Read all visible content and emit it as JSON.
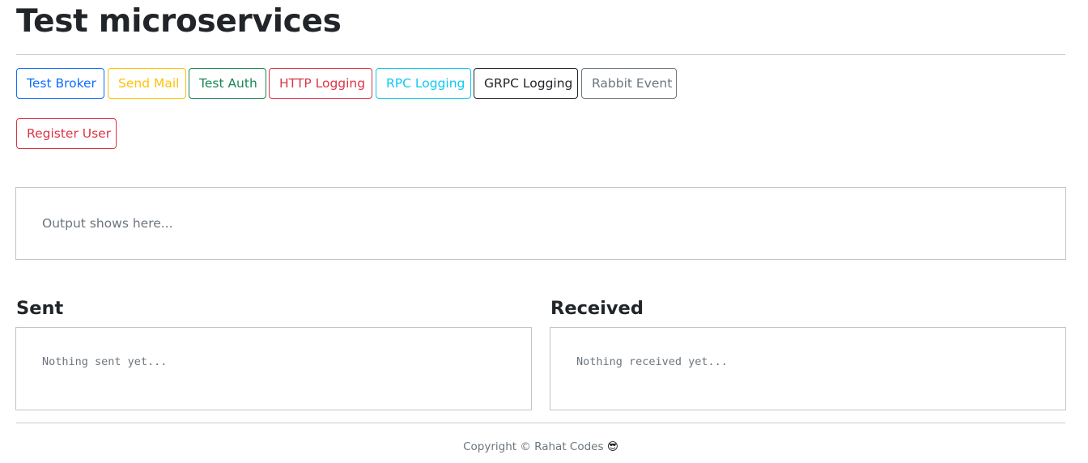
{
  "header": {
    "title": "Test microservices"
  },
  "buttons": [
    {
      "label": "Test Broker",
      "variant": "primary",
      "color": "#0d6efd"
    },
    {
      "label": "Send Mail",
      "variant": "warning",
      "color": "#ffc107"
    },
    {
      "label": "Test Auth",
      "variant": "success",
      "color": "#198754"
    },
    {
      "label": "HTTP Logging",
      "variant": "danger",
      "color": "#dc3545"
    },
    {
      "label": "RPC Logging",
      "variant": "info",
      "color": "#0dcaf0"
    },
    {
      "label": "GRPC Logging",
      "variant": "dark",
      "color": "#212529"
    },
    {
      "label": "Rabbit Event",
      "variant": "secondary",
      "color": "#6c757d"
    },
    {
      "label": "Register User",
      "variant": "danger",
      "color": "#dc3545"
    }
  ],
  "output": {
    "text": "Output shows here..."
  },
  "sent": {
    "title": "Sent",
    "content": "Nothing sent yet..."
  },
  "received": {
    "title": "Received",
    "content": "Nothing received yet..."
  },
  "footer": {
    "text": "Copyright © Rahat Codes",
    "emoji": "😎"
  }
}
